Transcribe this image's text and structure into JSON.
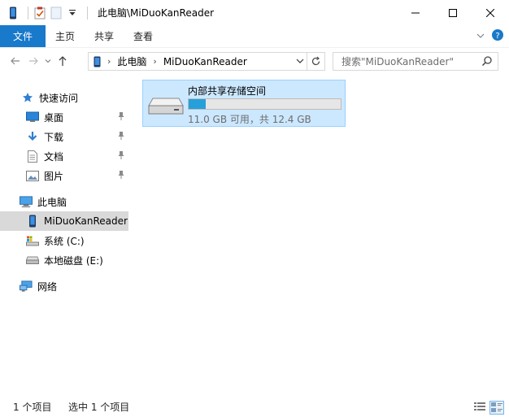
{
  "window": {
    "title": "此电脑\\MiDuoKanReader"
  },
  "ribbon": {
    "tabs": [
      "文件",
      "主页",
      "共享",
      "查看"
    ]
  },
  "address": {
    "crumbs": [
      "此电脑",
      "MiDuoKanReader"
    ],
    "search_placeholder": "搜索\"MiDuoKanReader\""
  },
  "nav": {
    "quick_access": "快速访问",
    "desktop": "桌面",
    "downloads": "下载",
    "documents": "文档",
    "pictures": "图片",
    "this_pc": "此电脑",
    "device": "MiDuoKanReader",
    "drive_c": "系统 (C:)",
    "drive_e": "本地磁盘 (E:)",
    "network": "网络"
  },
  "content": {
    "storage": {
      "name": "内部共享存储空间",
      "info": "11.0 GB 可用，共 12.4 GB",
      "used_fraction": 0.113
    }
  },
  "status": {
    "count": "1 个项目",
    "selected": "选中 1 个项目"
  },
  "colors": {
    "accent": "#1979ca",
    "selection": "#cce8ff",
    "progress": "#26a0da"
  }
}
